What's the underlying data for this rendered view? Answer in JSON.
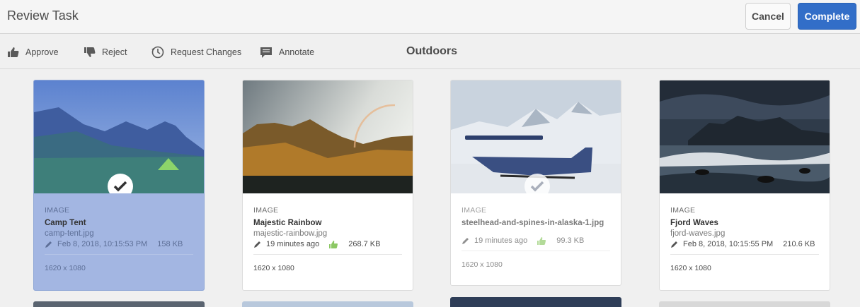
{
  "header": {
    "title": "Review Task",
    "cancel_label": "Cancel",
    "complete_label": "Complete"
  },
  "toolbar": {
    "approve": "Approve",
    "reject": "Reject",
    "request_changes": "Request Changes",
    "annotate": "Annotate",
    "collection_title": "Outdoors"
  },
  "colors": {
    "accent": "#326ec8",
    "selected": "#a3b6e2"
  },
  "cards": [
    {
      "type": "IMAGE",
      "name": "Camp Tent",
      "file": "camp-tent.jpg",
      "modified": "Feb 8, 2018, 10:15:53 PM",
      "size": "158 KB",
      "dims": "1620 x 1080",
      "selected": true
    },
    {
      "type": "IMAGE",
      "name": "Majestic Rainbow",
      "file": "majestic-rainbow.jpg",
      "modified": "19 minutes ago",
      "size": "268.7 KB",
      "dims": "1620 x 1080",
      "approved": true
    },
    {
      "type": "IMAGE",
      "name": "steelhead-and-spines-in-alaska-1.jpg",
      "modified": "19 minutes ago",
      "size": "99.3 KB",
      "dims": "1620 x 1080",
      "approved": true,
      "checked": true
    },
    {
      "type": "IMAGE",
      "name": "Fjord Waves",
      "file": "fjord-waves.jpg",
      "modified": "Feb 8, 2018, 10:15:55 PM",
      "size": "210.6 KB",
      "dims": "1620 x 1080"
    }
  ]
}
